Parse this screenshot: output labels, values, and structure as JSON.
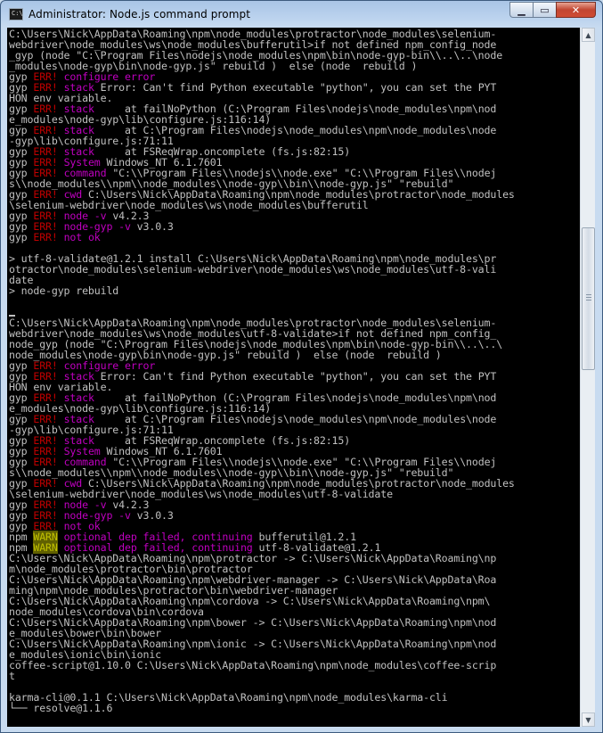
{
  "window": {
    "title": "Administrator: Node.js command prompt",
    "icon_label": "C:\\",
    "minimize_glyph": "▁",
    "maximize_glyph": "▭",
    "close_glyph": "✕"
  },
  "scrollbar": {
    "up_glyph": "▲",
    "down_glyph": "▼"
  },
  "colors": {
    "console_background": "#000000",
    "default_text": "#c0c0c0",
    "err_red": "#c00000",
    "err_purple": "#c000c0",
    "warn": "#c0c000"
  },
  "console": {
    "lines": [
      [
        {
          "t": "C:\\Users\\Nick\\AppData\\Roaming\\npm\\node_modules\\protractor\\node_modules\\selenium-"
        }
      ],
      [
        {
          "t": "webdriver\\node_modules\\ws\\node_modules\\bufferutil>if not defined npm_config_node"
        }
      ],
      [
        {
          "t": "_gyp (node \"C:\\Program Files\\nodejs\\node_modules\\npm\\bin\\node-gyp-bin\\\\..\\..\\node"
        }
      ],
      [
        {
          "t": "_modules\\node-gyp\\bin\\node-gyp.js\" rebuild )  else (node  rebuild )"
        }
      ],
      [
        {
          "t": "gyp "
        },
        {
          "t": "ERR!",
          "c": "red"
        },
        {
          "t": " configure error",
          "c": "purple"
        }
      ],
      [
        {
          "t": "gyp "
        },
        {
          "t": "ERR!",
          "c": "red"
        },
        {
          "t": " stack",
          "c": "purple"
        },
        {
          "t": " Error: Can't find Python executable \"python\", you can set the PYT"
        }
      ],
      [
        {
          "t": "HON env variable."
        }
      ],
      [
        {
          "t": "gyp "
        },
        {
          "t": "ERR!",
          "c": "red"
        },
        {
          "t": " stack",
          "c": "purple"
        },
        {
          "t": "     at failNoPython (C:\\Program Files\\nodejs\\node_modules\\npm\\nod"
        }
      ],
      [
        {
          "t": "e_modules\\node-gyp\\lib\\configure.js:116:14)"
        }
      ],
      [
        {
          "t": "gyp "
        },
        {
          "t": "ERR!",
          "c": "red"
        },
        {
          "t": " stack",
          "c": "purple"
        },
        {
          "t": "     at C:\\Program Files\\nodejs\\node_modules\\npm\\node_modules\\node"
        }
      ],
      [
        {
          "t": "-gyp\\lib\\configure.js:71:11"
        }
      ],
      [
        {
          "t": "gyp "
        },
        {
          "t": "ERR!",
          "c": "red"
        },
        {
          "t": " stack",
          "c": "purple"
        },
        {
          "t": "     at FSReqWrap.oncomplete (fs.js:82:15)"
        }
      ],
      [
        {
          "t": "gyp "
        },
        {
          "t": "ERR!",
          "c": "red"
        },
        {
          "t": " System",
          "c": "purple"
        },
        {
          "t": " Windows_NT 6.1.7601"
        }
      ],
      [
        {
          "t": "gyp "
        },
        {
          "t": "ERR!",
          "c": "red"
        },
        {
          "t": " command",
          "c": "purple"
        },
        {
          "t": " \"C:\\\\Program Files\\\\nodejs\\\\node.exe\" \"C:\\\\Program Files\\\\nodej"
        }
      ],
      [
        {
          "t": "s\\\\node_modules\\\\npm\\\\node_modules\\\\node-gyp\\\\bin\\\\node-gyp.js\" \"rebuild\""
        }
      ],
      [
        {
          "t": "gyp "
        },
        {
          "t": "ERR!",
          "c": "red"
        },
        {
          "t": " cwd",
          "c": "purple"
        },
        {
          "t": " C:\\Users\\Nick\\AppData\\Roaming\\npm\\node_modules\\protractor\\node_modules"
        }
      ],
      [
        {
          "t": "\\selenium-webdriver\\node_modules\\ws\\node_modules\\bufferutil"
        }
      ],
      [
        {
          "t": "gyp "
        },
        {
          "t": "ERR!",
          "c": "red"
        },
        {
          "t": " node -v",
          "c": "purple"
        },
        {
          "t": " v4.2.3"
        }
      ],
      [
        {
          "t": "gyp "
        },
        {
          "t": "ERR!",
          "c": "red"
        },
        {
          "t": " node-gyp -v",
          "c": "purple"
        },
        {
          "t": " v3.0.3"
        }
      ],
      [
        {
          "t": "gyp "
        },
        {
          "t": "ERR!",
          "c": "red"
        },
        {
          "t": " not ok",
          "c": "purple"
        }
      ],
      [
        {
          "t": ""
        }
      ],
      [
        {
          "t": "> utf-8-validate@1.2.1 install C:\\Users\\Nick\\AppData\\Roaming\\npm\\node_modules\\pr"
        }
      ],
      [
        {
          "t": "otractor\\node_modules\\selenium-webdriver\\node_modules\\ws\\node_modules\\utf-8-vali"
        }
      ],
      [
        {
          "t": "date"
        }
      ],
      [
        {
          "t": "> node-gyp rebuild"
        }
      ],
      [
        {
          "t": ""
        }
      ],
      [
        {
          "t": "",
          "cursor": true
        }
      ],
      [
        {
          "t": "C:\\Users\\Nick\\AppData\\Roaming\\npm\\node_modules\\protractor\\node_modules\\selenium-"
        }
      ],
      [
        {
          "t": "webdriver\\node_modules\\ws\\node_modules\\utf-8-validate>if not defined npm_config_"
        }
      ],
      [
        {
          "t": "node_gyp (node \"C:\\Program Files\\nodejs\\node_modules\\npm\\bin\\node-gyp-bin\\\\..\\..\\"
        }
      ],
      [
        {
          "t": "node_modules\\node-gyp\\bin\\node-gyp.js\" rebuild )  else (node  rebuild )"
        }
      ],
      [
        {
          "t": "gyp "
        },
        {
          "t": "ERR!",
          "c": "red"
        },
        {
          "t": " configure error",
          "c": "purple"
        }
      ],
      [
        {
          "t": "gyp "
        },
        {
          "t": "ERR!",
          "c": "red"
        },
        {
          "t": " stack",
          "c": "purple"
        },
        {
          "t": " Error: Can't find Python executable \"python\", you can set the PYT"
        }
      ],
      [
        {
          "t": "HON env variable."
        }
      ],
      [
        {
          "t": "gyp "
        },
        {
          "t": "ERR!",
          "c": "red"
        },
        {
          "t": " stack",
          "c": "purple"
        },
        {
          "t": "     at failNoPython (C:\\Program Files\\nodejs\\node_modules\\npm\\nod"
        }
      ],
      [
        {
          "t": "e_modules\\node-gyp\\lib\\configure.js:116:14)"
        }
      ],
      [
        {
          "t": "gyp "
        },
        {
          "t": "ERR!",
          "c": "red"
        },
        {
          "t": " stack",
          "c": "purple"
        },
        {
          "t": "     at C:\\Program Files\\nodejs\\node_modules\\npm\\node_modules\\node"
        }
      ],
      [
        {
          "t": "-gyp\\lib\\configure.js:71:11"
        }
      ],
      [
        {
          "t": "gyp "
        },
        {
          "t": "ERR!",
          "c": "red"
        },
        {
          "t": " stack",
          "c": "purple"
        },
        {
          "t": "     at FSReqWrap.oncomplete (fs.js:82:15)"
        }
      ],
      [
        {
          "t": "gyp "
        },
        {
          "t": "ERR!",
          "c": "red"
        },
        {
          "t": " System",
          "c": "purple"
        },
        {
          "t": " Windows_NT 6.1.7601"
        }
      ],
      [
        {
          "t": "gyp "
        },
        {
          "t": "ERR!",
          "c": "red"
        },
        {
          "t": " command",
          "c": "purple"
        },
        {
          "t": " \"C:\\\\Program Files\\\\nodejs\\\\node.exe\" \"C:\\\\Program Files\\\\nodej"
        }
      ],
      [
        {
          "t": "s\\\\node_modules\\\\npm\\\\node_modules\\\\node-gyp\\\\bin\\\\node-gyp.js\" \"rebuild\""
        }
      ],
      [
        {
          "t": "gyp "
        },
        {
          "t": "ERR!",
          "c": "red"
        },
        {
          "t": " cwd",
          "c": "purple"
        },
        {
          "t": " C:\\Users\\Nick\\AppData\\Roaming\\npm\\node_modules\\protractor\\node_modules"
        }
      ],
      [
        {
          "t": "\\selenium-webdriver\\node_modules\\ws\\node_modules\\utf-8-validate"
        }
      ],
      [
        {
          "t": "gyp "
        },
        {
          "t": "ERR!",
          "c": "red"
        },
        {
          "t": " node -v",
          "c": "purple"
        },
        {
          "t": " v4.2.3"
        }
      ],
      [
        {
          "t": "gyp "
        },
        {
          "t": "ERR!",
          "c": "red"
        },
        {
          "t": " node-gyp -v",
          "c": "purple"
        },
        {
          "t": " v3.0.3"
        }
      ],
      [
        {
          "t": "gyp "
        },
        {
          "t": "ERR!",
          "c": "red"
        },
        {
          "t": " not ok",
          "c": "purple"
        }
      ],
      [
        {
          "t": "npm "
        },
        {
          "t": "WARN",
          "c": "warn"
        },
        {
          "t": " optional dep failed, continuing",
          "c": "purple"
        },
        {
          "t": " bufferutil@1.2.1"
        }
      ],
      [
        {
          "t": "npm "
        },
        {
          "t": "WARN",
          "c": "warn"
        },
        {
          "t": " optional dep failed, continuing",
          "c": "purple"
        },
        {
          "t": " utf-8-validate@1.2.1"
        }
      ],
      [
        {
          "t": "C:\\Users\\Nick\\AppData\\Roaming\\npm\\protractor -> C:\\Users\\Nick\\AppData\\Roaming\\np"
        }
      ],
      [
        {
          "t": "m\\node_modules\\protractor\\bin\\protractor"
        }
      ],
      [
        {
          "t": "C:\\Users\\Nick\\AppData\\Roaming\\npm\\webdriver-manager -> C:\\Users\\Nick\\AppData\\Roa"
        }
      ],
      [
        {
          "t": "ming\\npm\\node_modules\\protractor\\bin\\webdriver-manager"
        }
      ],
      [
        {
          "t": "C:\\Users\\Nick\\AppData\\Roaming\\npm\\cordova -> C:\\Users\\Nick\\AppData\\Roaming\\npm\\"
        }
      ],
      [
        {
          "t": "node_modules\\cordova\\bin\\cordova"
        }
      ],
      [
        {
          "t": "C:\\Users\\Nick\\AppData\\Roaming\\npm\\bower -> C:\\Users\\Nick\\AppData\\Roaming\\npm\\nod"
        }
      ],
      [
        {
          "t": "e_modules\\bower\\bin\\bower"
        }
      ],
      [
        {
          "t": "C:\\Users\\Nick\\AppData\\Roaming\\npm\\ionic -> C:\\Users\\Nick\\AppData\\Roaming\\npm\\nod"
        }
      ],
      [
        {
          "t": "e_modules\\ionic\\bin\\ionic"
        }
      ],
      [
        {
          "t": "coffee-script@1.10.0 C:\\Users\\Nick\\AppData\\Roaming\\npm\\node_modules\\coffee-scrip"
        }
      ],
      [
        {
          "t": "t"
        }
      ],
      [
        {
          "t": ""
        }
      ],
      [
        {
          "t": "karma-cli@0.1.1 C:\\Users\\Nick\\AppData\\Roaming\\npm\\node_modules\\karma-cli"
        }
      ],
      [
        {
          "t": "└── resolve@1.1.6"
        }
      ]
    ]
  }
}
